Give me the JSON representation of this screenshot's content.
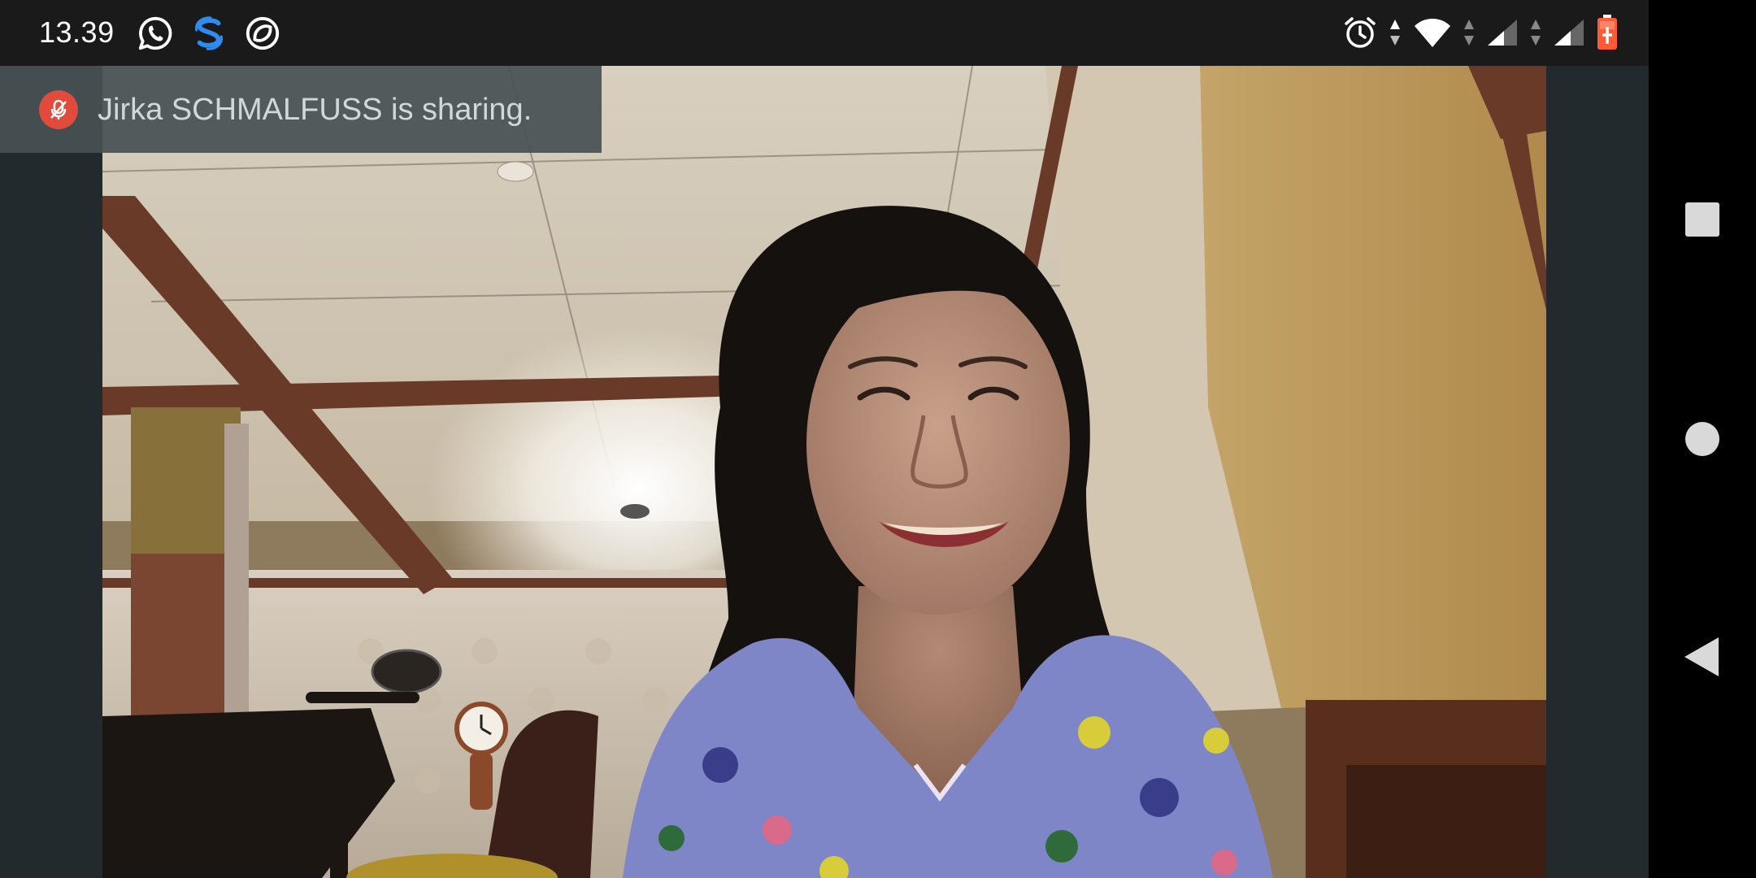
{
  "status_bar": {
    "time": "13.39",
    "notification_icons": [
      "whatsapp-icon",
      "skype-icon",
      "sync-icon"
    ],
    "system_icons": [
      "alarm-icon",
      "data-arrows-icon",
      "wifi-icon",
      "signal-icon",
      "signal-icon-2",
      "battery-charging-icon"
    ]
  },
  "meeting": {
    "sharing_banner": "Jirka SCHMALFUSS is sharing.",
    "banner_icon": "mic-muted-icon"
  },
  "nav_bar": {
    "buttons": [
      "recents-button",
      "home-button",
      "back-button"
    ]
  },
  "colors": {
    "status_bar_bg": "#1a1a1a",
    "banner_bg": "#485054",
    "mute_badge": "#e04b3c",
    "skype_blue": "#2d8cf0",
    "battery_accent": "#ff5a36",
    "nav_bg": "#000000"
  }
}
